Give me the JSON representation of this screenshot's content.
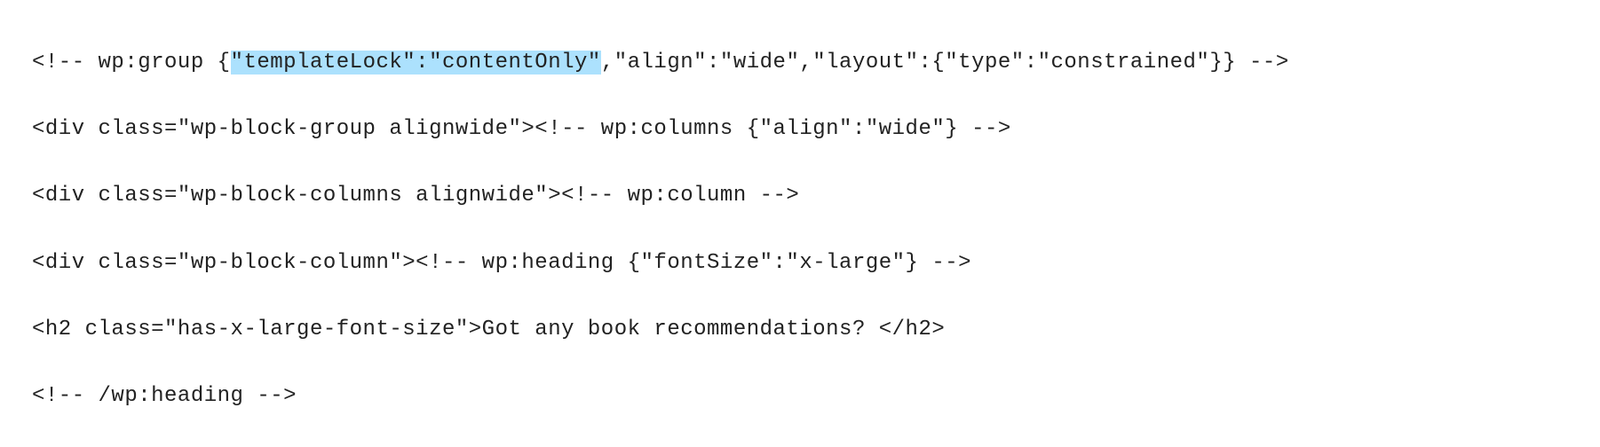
{
  "code": {
    "lines": [
      {
        "segments": [
          {
            "t": "<!-- wp:group {",
            "hl": false
          },
          {
            "t": "\"templateLock\":\"contentOnly\"",
            "hl": true
          },
          {
            "t": ",\"align\":\"wide\",\"layout\":{\"type\":\"constrained\"}} -->",
            "hl": false
          }
        ]
      },
      {
        "segments": [
          {
            "t": "<div class=\"wp-block-group alignwide\"><!-- wp:columns {\"align\":\"wide\"} -->",
            "hl": false
          }
        ]
      },
      {
        "segments": [
          {
            "t": "<div class=\"wp-block-columns alignwide\"><!-- wp:column -->",
            "hl": false
          }
        ]
      },
      {
        "segments": [
          {
            "t": "<div class=\"wp-block-column\"><!-- wp:heading {\"fontSize\":\"x-large\"} -->",
            "hl": false
          }
        ]
      },
      {
        "segments": [
          {
            "t": "<h2 class=\"has-x-large-font-size\">Got any book recommendations? </h2>",
            "hl": false
          }
        ]
      },
      {
        "segments": [
          {
            "t": "<!-- /wp:heading -->",
            "hl": false
          }
        ]
      }
    ]
  }
}
